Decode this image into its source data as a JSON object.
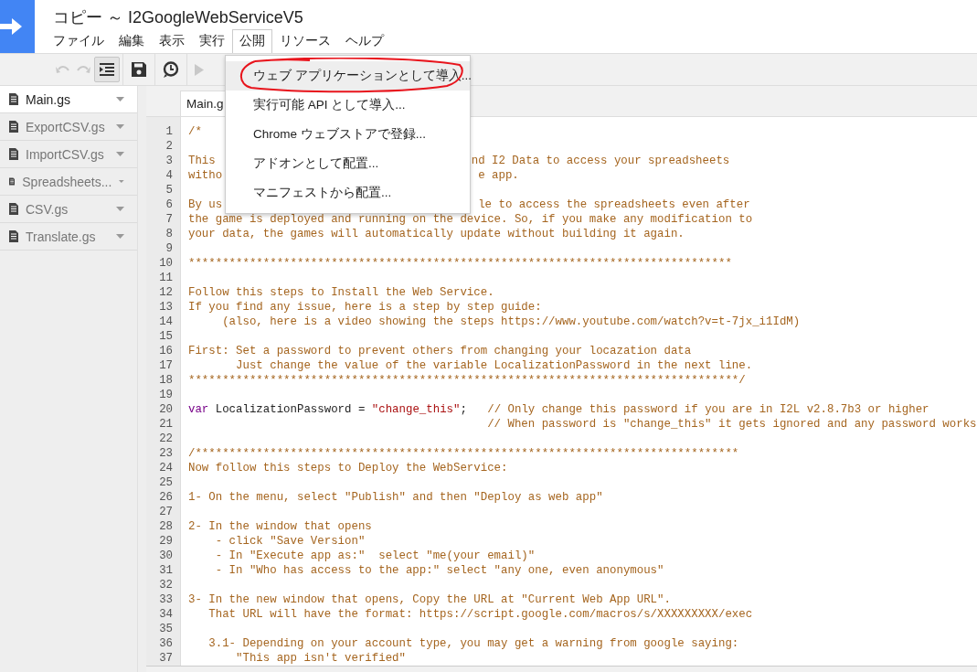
{
  "window": {
    "title": "コピー ～ I2GoogleWebServiceV5"
  },
  "menu_bar": [
    {
      "label": "ファイル",
      "selected": false
    },
    {
      "label": "編集",
      "selected": false
    },
    {
      "label": "表示",
      "selected": false
    },
    {
      "label": "実行",
      "selected": false
    },
    {
      "label": "公開",
      "selected": true
    },
    {
      "label": "リソース",
      "selected": false
    },
    {
      "label": "ヘルプ",
      "selected": false
    }
  ],
  "toolbar": [
    {
      "kind": "undo",
      "disabled": true
    },
    {
      "kind": "redo",
      "disabled": true
    },
    {
      "kind": "indent",
      "on": true
    },
    {
      "kind": "save",
      "disabled": false
    },
    {
      "kind": "trigger",
      "disabled": false
    },
    {
      "kind": "run",
      "disabled": true
    }
  ],
  "files": [
    {
      "name": "Main.gs",
      "selected": true
    },
    {
      "name": "ExportCSV.gs",
      "selected": false
    },
    {
      "name": "ImportCSV.gs",
      "selected": false
    },
    {
      "name": "Spreadsheets...",
      "selected": false
    },
    {
      "name": "CSV.gs",
      "selected": false
    },
    {
      "name": "Translate.gs",
      "selected": false
    }
  ],
  "editor_tab": {
    "label": "Main.g"
  },
  "publish_menu": [
    {
      "label": "ウェブ アプリケーションとして導入...",
      "selected": true,
      "annotated": true
    },
    {
      "label": "実行可能 API として導入...",
      "selected": false,
      "annotated": false
    },
    {
      "label": "Chrome ウェブストアで登録...",
      "selected": false,
      "annotated": false
    },
    {
      "label": "アドオンとして配置...",
      "selected": false,
      "annotated": false
    },
    {
      "label": "マニフェストから配置...",
      "selected": false,
      "annotated": false
    }
  ],
  "code_lines": [
    {
      "number": "1",
      "segments": [
        {
          "text": "/*",
          "kind": "comment"
        }
      ]
    },
    {
      "number": "2"
    },
    {
      "number": "3",
      "segments": [
        {
          "text": "This",
          "kind": "comment"
        }
      ],
      "tail": [
        {
          "text": "nd I2 Data to access your spreadsheets",
          "kind": "comment"
        }
      ]
    },
    {
      "number": "4",
      "segments": [
        {
          "text": "witho",
          "kind": "comment"
        }
      ],
      "tail": [
        {
          "text": "e app.",
          "kind": "comment"
        }
      ]
    },
    {
      "number": "5"
    },
    {
      "number": "6",
      "segments": [
        {
          "text": "By us",
          "kind": "comment"
        }
      ],
      "tail": [
        {
          "text": "le to access the spreadsheets even after",
          "kind": "comment"
        }
      ]
    },
    {
      "number": "7",
      "segments": [
        {
          "text": "the game is deployed and running on the device. So, if you make any modification to",
          "kind": "comment"
        }
      ]
    },
    {
      "number": "8",
      "segments": [
        {
          "text": "your data, the games will automatically update without building it again.",
          "kind": "comment"
        }
      ]
    },
    {
      "number": "9"
    },
    {
      "number": "10",
      "segments": [
        {
          "text": "********************************************************************************",
          "kind": "comment"
        }
      ]
    },
    {
      "number": "11"
    },
    {
      "number": "12",
      "segments": [
        {
          "text": "Follow this steps to Install the Web Service.",
          "kind": "comment"
        }
      ]
    },
    {
      "number": "13",
      "segments": [
        {
          "text": "If you find any issue, here is a step by step guide:",
          "kind": "comment"
        }
      ]
    },
    {
      "number": "14",
      "segments": [
        {
          "text": "     (also, here is a video showing the steps https://www.youtube.com/watch?v=t-7jx_i1IdM)",
          "kind": "comment"
        }
      ]
    },
    {
      "number": "15"
    },
    {
      "number": "16",
      "segments": [
        {
          "text": "First: Set a password to prevent others from changing your locazation data",
          "kind": "comment"
        }
      ]
    },
    {
      "number": "17",
      "segments": [
        {
          "text": "       Just change the value of the variable LocalizationPassword in the next line.",
          "kind": "comment"
        }
      ]
    },
    {
      "number": "18",
      "segments": [
        {
          "text": "*********************************************************************************/",
          "kind": "comment"
        }
      ]
    },
    {
      "number": "19"
    },
    {
      "number": "20",
      "segments": [
        {
          "text": "var",
          "kind": "keyword"
        },
        {
          "text": " LocalizationPassword = ",
          "kind": "plain"
        },
        {
          "text": "\"change_this\"",
          "kind": "string"
        },
        {
          "text": ";   ",
          "kind": "plain"
        },
        {
          "text": "// Only change this password if you are in I2L v2.8.7b3 or higher",
          "kind": "comment"
        }
      ]
    },
    {
      "number": "21",
      "segments": [
        {
          "text": "                                            // When password is \"change_this\" it gets ignored and any password works",
          "kind": "comment"
        }
      ]
    },
    {
      "number": "22"
    },
    {
      "number": "23",
      "segments": [
        {
          "text": "/********************************************************************************",
          "kind": "comment"
        }
      ]
    },
    {
      "number": "24",
      "segments": [
        {
          "text": "Now follow this steps to Deploy the WebService:",
          "kind": "comment"
        }
      ]
    },
    {
      "number": "25"
    },
    {
      "number": "26",
      "segments": [
        {
          "text": "1- On the menu, select \"Publish\" and then \"Deploy as web app\"",
          "kind": "comment"
        }
      ]
    },
    {
      "number": "27"
    },
    {
      "number": "28",
      "segments": [
        {
          "text": "2- In the window that opens",
          "kind": "comment"
        }
      ]
    },
    {
      "number": "29",
      "segments": [
        {
          "text": "    - click \"Save Version\"",
          "kind": "comment"
        }
      ]
    },
    {
      "number": "30",
      "segments": [
        {
          "text": "    - In \"Execute app as:\"  select \"me(your email)\"",
          "kind": "comment"
        }
      ]
    },
    {
      "number": "31",
      "segments": [
        {
          "text": "    - In \"Who has access to the app:\" select \"any one, even anonymous\"",
          "kind": "comment"
        }
      ]
    },
    {
      "number": "32"
    },
    {
      "number": "33",
      "segments": [
        {
          "text": "3- In the new window that opens, Copy the URL at \"Current Web App URL\".",
          "kind": "comment"
        }
      ]
    },
    {
      "number": "34",
      "segments": [
        {
          "text": "   That URL will have the format: https://script.google.com/macros/s/XXXXXXXXX/exec",
          "kind": "comment"
        }
      ]
    },
    {
      "number": "35"
    },
    {
      "number": "36",
      "segments": [
        {
          "text": "   3.1- Depending on your account type, you may get a warning from google saying:",
          "kind": "comment"
        }
      ]
    },
    {
      "number": "37",
      "segments": [
        {
          "text": "       \"This app isn't verified\"",
          "kind": "comment"
        }
      ]
    }
  ]
}
